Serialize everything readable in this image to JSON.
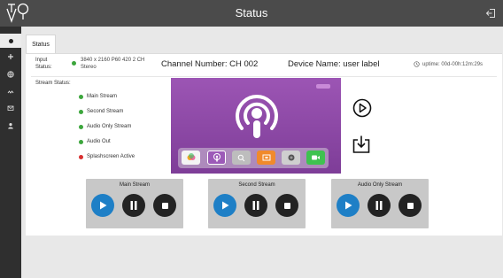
{
  "header": {
    "title": "Status",
    "logo_icon": "vq-logo-icon",
    "logout_icon": "logout-icon"
  },
  "sidebar": {
    "items": [
      {
        "name": "status",
        "icon": "dot-icon",
        "active": true
      },
      {
        "name": "add",
        "icon": "plus-icon"
      },
      {
        "name": "network",
        "icon": "globe-icon"
      },
      {
        "name": "streams",
        "icon": "wave-icon"
      },
      {
        "name": "mail",
        "icon": "mail-icon"
      },
      {
        "name": "user",
        "icon": "user-icon"
      }
    ]
  },
  "tabs": [
    {
      "label": "Status"
    }
  ],
  "input": {
    "label_line1": "Input",
    "label_line2": "Status:",
    "value_line1": "3840 x 2160 P60 420 2 CH",
    "value_line2": "Stereo",
    "status_color": "#3ca63c"
  },
  "channel": {
    "text": "Channel Number: CH 002"
  },
  "device": {
    "text": "Device Name: user label"
  },
  "uptime": {
    "text": "uptime: 00d-00h:12m:29s",
    "icon": "clock-icon"
  },
  "stream_status": {
    "label": "Stream Status:",
    "items": [
      {
        "label": "Main Stream",
        "status": "green"
      },
      {
        "label": "Second Stream",
        "status": "green"
      },
      {
        "label": "Audio Only Stream",
        "status": "green"
      },
      {
        "label": "Audio Out",
        "status": "green"
      },
      {
        "label": "Splashscreen Active",
        "status": "red"
      }
    ]
  },
  "preview": {
    "background": "#8a47a6",
    "apps": [
      "photos-app-icon",
      "podcasts-app-icon",
      "search-app-icon",
      "tv-app-icon",
      "camera-app-icon",
      "facetime-app-icon"
    ]
  },
  "actions": {
    "play_icon": "play-circle-icon",
    "download_icon": "download-icon"
  },
  "stream_controls": [
    {
      "label": "Main Stream"
    },
    {
      "label": "Second Stream"
    },
    {
      "label": "Audio Only Stream"
    }
  ],
  "colors": {
    "header_bg": "#4b4b4b",
    "sidebar_bg": "#2f2f2f",
    "play_blue": "#1e7fc6",
    "dark_btn": "#232323"
  }
}
